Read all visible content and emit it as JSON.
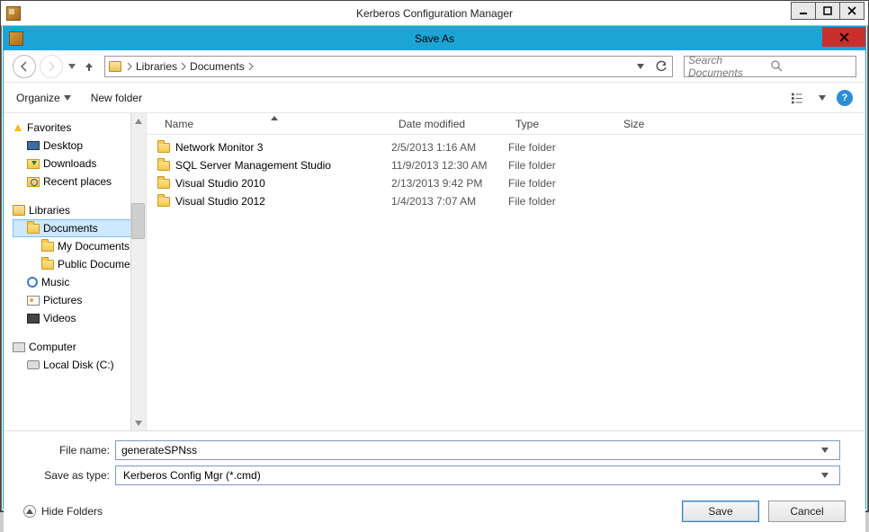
{
  "outer_window": {
    "title": "Kerberos Configuration Manager"
  },
  "dialog": {
    "title": "Save As"
  },
  "breadcrumb": {
    "root": "Libraries",
    "folder": "Documents"
  },
  "search": {
    "placeholder": "Search Documents"
  },
  "toolbar": {
    "organize": "Organize",
    "new_folder": "New folder"
  },
  "tree": {
    "favorites": {
      "label": "Favorites",
      "items": [
        {
          "label": "Desktop"
        },
        {
          "label": "Downloads"
        },
        {
          "label": "Recent places"
        }
      ]
    },
    "libraries": {
      "label": "Libraries",
      "items": [
        {
          "label": "Documents",
          "children": [
            {
              "label": "My Documents"
            },
            {
              "label": "Public Documents"
            }
          ]
        },
        {
          "label": "Music"
        },
        {
          "label": "Pictures"
        },
        {
          "label": "Videos"
        }
      ]
    },
    "computer": {
      "label": "Computer",
      "items": [
        {
          "label": "Local Disk (C:)"
        }
      ]
    }
  },
  "columns": {
    "name": "Name",
    "date": "Date modified",
    "type": "Type",
    "size": "Size"
  },
  "files": [
    {
      "name": "Network Monitor 3",
      "date": "2/5/2013 1:16 AM",
      "type": "File folder",
      "size": ""
    },
    {
      "name": "SQL Server Management Studio",
      "date": "11/9/2013 12:30 AM",
      "type": "File folder",
      "size": ""
    },
    {
      "name": "Visual Studio 2010",
      "date": "2/13/2013 9:42 PM",
      "type": "File folder",
      "size": ""
    },
    {
      "name": "Visual Studio 2012",
      "date": "1/4/2013 7:07 AM",
      "type": "File folder",
      "size": ""
    }
  ],
  "fields": {
    "filename_label": "File name:",
    "filename_value": "generateSPNss",
    "type_label": "Save as type:",
    "type_value": "Kerberos Config Mgr (*.cmd)"
  },
  "footer": {
    "hide_folders": "Hide Folders",
    "save": "Save",
    "cancel": "Cancel"
  }
}
